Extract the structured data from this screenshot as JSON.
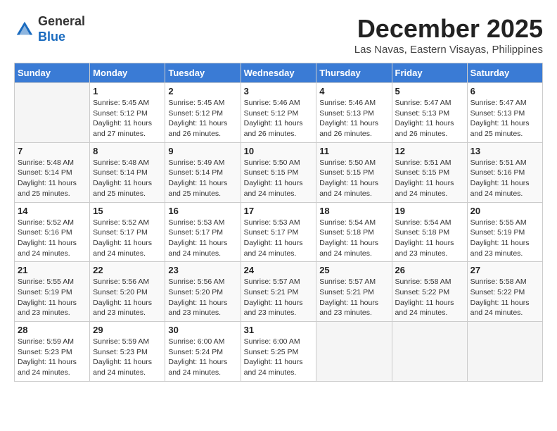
{
  "header": {
    "logo_general": "General",
    "logo_blue": "Blue",
    "month_title": "December 2025",
    "location": "Las Navas, Eastern Visayas, Philippines"
  },
  "days_of_week": [
    "Sunday",
    "Monday",
    "Tuesday",
    "Wednesday",
    "Thursday",
    "Friday",
    "Saturday"
  ],
  "weeks": [
    [
      {
        "day": "",
        "sunrise": "",
        "sunset": "",
        "daylight": ""
      },
      {
        "day": "1",
        "sunrise": "Sunrise: 5:45 AM",
        "sunset": "Sunset: 5:12 PM",
        "daylight": "Daylight: 11 hours and 27 minutes."
      },
      {
        "day": "2",
        "sunrise": "Sunrise: 5:45 AM",
        "sunset": "Sunset: 5:12 PM",
        "daylight": "Daylight: 11 hours and 26 minutes."
      },
      {
        "day": "3",
        "sunrise": "Sunrise: 5:46 AM",
        "sunset": "Sunset: 5:12 PM",
        "daylight": "Daylight: 11 hours and 26 minutes."
      },
      {
        "day": "4",
        "sunrise": "Sunrise: 5:46 AM",
        "sunset": "Sunset: 5:13 PM",
        "daylight": "Daylight: 11 hours and 26 minutes."
      },
      {
        "day": "5",
        "sunrise": "Sunrise: 5:47 AM",
        "sunset": "Sunset: 5:13 PM",
        "daylight": "Daylight: 11 hours and 26 minutes."
      },
      {
        "day": "6",
        "sunrise": "Sunrise: 5:47 AM",
        "sunset": "Sunset: 5:13 PM",
        "daylight": "Daylight: 11 hours and 25 minutes."
      }
    ],
    [
      {
        "day": "7",
        "sunrise": "Sunrise: 5:48 AM",
        "sunset": "Sunset: 5:14 PM",
        "daylight": "Daylight: 11 hours and 25 minutes."
      },
      {
        "day": "8",
        "sunrise": "Sunrise: 5:48 AM",
        "sunset": "Sunset: 5:14 PM",
        "daylight": "Daylight: 11 hours and 25 minutes."
      },
      {
        "day": "9",
        "sunrise": "Sunrise: 5:49 AM",
        "sunset": "Sunset: 5:14 PM",
        "daylight": "Daylight: 11 hours and 25 minutes."
      },
      {
        "day": "10",
        "sunrise": "Sunrise: 5:50 AM",
        "sunset": "Sunset: 5:15 PM",
        "daylight": "Daylight: 11 hours and 24 minutes."
      },
      {
        "day": "11",
        "sunrise": "Sunrise: 5:50 AM",
        "sunset": "Sunset: 5:15 PM",
        "daylight": "Daylight: 11 hours and 24 minutes."
      },
      {
        "day": "12",
        "sunrise": "Sunrise: 5:51 AM",
        "sunset": "Sunset: 5:15 PM",
        "daylight": "Daylight: 11 hours and 24 minutes."
      },
      {
        "day": "13",
        "sunrise": "Sunrise: 5:51 AM",
        "sunset": "Sunset: 5:16 PM",
        "daylight": "Daylight: 11 hours and 24 minutes."
      }
    ],
    [
      {
        "day": "14",
        "sunrise": "Sunrise: 5:52 AM",
        "sunset": "Sunset: 5:16 PM",
        "daylight": "Daylight: 11 hours and 24 minutes."
      },
      {
        "day": "15",
        "sunrise": "Sunrise: 5:52 AM",
        "sunset": "Sunset: 5:17 PM",
        "daylight": "Daylight: 11 hours and 24 minutes."
      },
      {
        "day": "16",
        "sunrise": "Sunrise: 5:53 AM",
        "sunset": "Sunset: 5:17 PM",
        "daylight": "Daylight: 11 hours and 24 minutes."
      },
      {
        "day": "17",
        "sunrise": "Sunrise: 5:53 AM",
        "sunset": "Sunset: 5:17 PM",
        "daylight": "Daylight: 11 hours and 24 minutes."
      },
      {
        "day": "18",
        "sunrise": "Sunrise: 5:54 AM",
        "sunset": "Sunset: 5:18 PM",
        "daylight": "Daylight: 11 hours and 24 minutes."
      },
      {
        "day": "19",
        "sunrise": "Sunrise: 5:54 AM",
        "sunset": "Sunset: 5:18 PM",
        "daylight": "Daylight: 11 hours and 23 minutes."
      },
      {
        "day": "20",
        "sunrise": "Sunrise: 5:55 AM",
        "sunset": "Sunset: 5:19 PM",
        "daylight": "Daylight: 11 hours and 23 minutes."
      }
    ],
    [
      {
        "day": "21",
        "sunrise": "Sunrise: 5:55 AM",
        "sunset": "Sunset: 5:19 PM",
        "daylight": "Daylight: 11 hours and 23 minutes."
      },
      {
        "day": "22",
        "sunrise": "Sunrise: 5:56 AM",
        "sunset": "Sunset: 5:20 PM",
        "daylight": "Daylight: 11 hours and 23 minutes."
      },
      {
        "day": "23",
        "sunrise": "Sunrise: 5:56 AM",
        "sunset": "Sunset: 5:20 PM",
        "daylight": "Daylight: 11 hours and 23 minutes."
      },
      {
        "day": "24",
        "sunrise": "Sunrise: 5:57 AM",
        "sunset": "Sunset: 5:21 PM",
        "daylight": "Daylight: 11 hours and 23 minutes."
      },
      {
        "day": "25",
        "sunrise": "Sunrise: 5:57 AM",
        "sunset": "Sunset: 5:21 PM",
        "daylight": "Daylight: 11 hours and 23 minutes."
      },
      {
        "day": "26",
        "sunrise": "Sunrise: 5:58 AM",
        "sunset": "Sunset: 5:22 PM",
        "daylight": "Daylight: 11 hours and 24 minutes."
      },
      {
        "day": "27",
        "sunrise": "Sunrise: 5:58 AM",
        "sunset": "Sunset: 5:22 PM",
        "daylight": "Daylight: 11 hours and 24 minutes."
      }
    ],
    [
      {
        "day": "28",
        "sunrise": "Sunrise: 5:59 AM",
        "sunset": "Sunset: 5:23 PM",
        "daylight": "Daylight: 11 hours and 24 minutes."
      },
      {
        "day": "29",
        "sunrise": "Sunrise: 5:59 AM",
        "sunset": "Sunset: 5:23 PM",
        "daylight": "Daylight: 11 hours and 24 minutes."
      },
      {
        "day": "30",
        "sunrise": "Sunrise: 6:00 AM",
        "sunset": "Sunset: 5:24 PM",
        "daylight": "Daylight: 11 hours and 24 minutes."
      },
      {
        "day": "31",
        "sunrise": "Sunrise: 6:00 AM",
        "sunset": "Sunset: 5:25 PM",
        "daylight": "Daylight: 11 hours and 24 minutes."
      },
      {
        "day": "",
        "sunrise": "",
        "sunset": "",
        "daylight": ""
      },
      {
        "day": "",
        "sunrise": "",
        "sunset": "",
        "daylight": ""
      },
      {
        "day": "",
        "sunrise": "",
        "sunset": "",
        "daylight": ""
      }
    ]
  ]
}
